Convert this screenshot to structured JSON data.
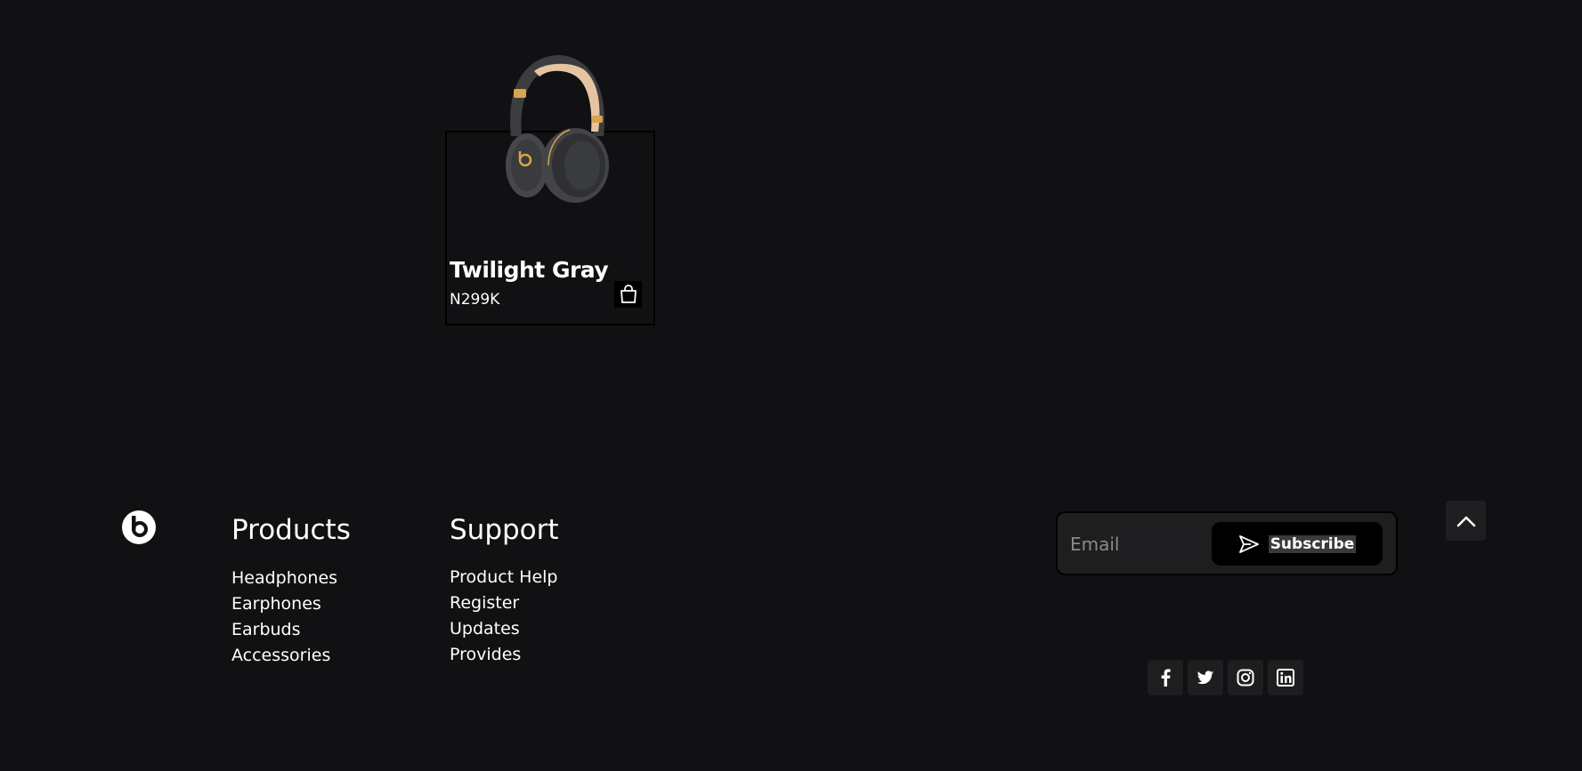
{
  "product": {
    "name": "Twilight Gray",
    "price": "N299K",
    "image_icon": "headphones-image",
    "cart_icon": "shopping-bag-icon"
  },
  "footer": {
    "logo_icon": "beats-logo-icon",
    "products": {
      "title": "Products",
      "links": [
        "Headphones",
        "Earphones",
        "Earbuds",
        "Accessories"
      ]
    },
    "support": {
      "title": "Support",
      "links": [
        "Product Help",
        "Register",
        "Updates",
        "Provides"
      ]
    },
    "subscribe": {
      "placeholder": "Email",
      "button_label": "Subscribe",
      "button_icon": "send-icon"
    },
    "back_to_top_icon": "chevron-up-icon",
    "social": [
      {
        "name": "facebook",
        "icon": "facebook-icon"
      },
      {
        "name": "twitter",
        "icon": "twitter-icon"
      },
      {
        "name": "instagram",
        "icon": "instagram-icon"
      },
      {
        "name": "linkedin",
        "icon": "linkedin-icon"
      }
    ]
  },
  "colors": {
    "background": "#111113",
    "surface": "#1e1e20",
    "button": "#000000",
    "text": "#ffffff",
    "placeholder": "#8a8a8a",
    "headphone_body": "#3c3d3f",
    "headphone_band": "#e6c4a2",
    "headphone_accent": "#d8a54a"
  }
}
